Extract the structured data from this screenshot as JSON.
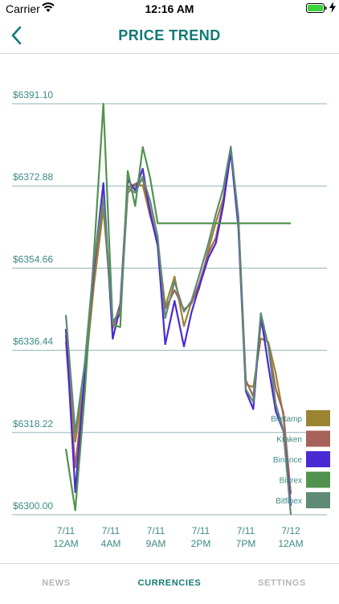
{
  "status_bar": {
    "carrier": "Carrier",
    "time": "12:16 AM"
  },
  "nav": {
    "title": "PRICE TREND",
    "back_icon": "chevron-left-icon"
  },
  "tabs": [
    {
      "label": "NEWS",
      "active": false
    },
    {
      "label": "CURRENCIES",
      "active": true
    },
    {
      "label": "SETTINGS",
      "active": false
    }
  ],
  "colors": {
    "accent": "#117a75",
    "gridline": "#8fb6b6",
    "axis_text": "#3d8a86"
  },
  "chart_data": {
    "type": "line",
    "ylim": [
      6300.0,
      6391.1
    ],
    "y_ticks": [
      6300.0,
      6318.22,
      6336.44,
      6354.66,
      6372.88,
      6391.1
    ],
    "y_tick_labels": [
      "$6300.00",
      "$6318.22",
      "$6336.44",
      "$6354.66",
      "$6372.88",
      "$6391.10"
    ],
    "x_range": [
      -0.3,
      12.55
    ],
    "x_ticks": [
      0,
      2.4,
      4.8,
      7.2,
      9.6,
      12
    ],
    "x_tick_labels": [
      [
        "7/11",
        "12AM"
      ],
      [
        "7/11",
        "4AM"
      ],
      [
        "7/11",
        "9AM"
      ],
      [
        "7/11",
        "2PM"
      ],
      [
        "7/11",
        "7PM"
      ],
      [
        "7/12",
        "12AM"
      ]
    ],
    "x": [
      0,
      0.5,
      1,
      1.5,
      2,
      2.5,
      2.9,
      3.3,
      3.7,
      4.1,
      4.5,
      4.9,
      5.3,
      5.8,
      6.3,
      6.7,
      7.1,
      7.6,
      8.0,
      8.4,
      8.8,
      9.2,
      9.6,
      10.0,
      10.4,
      10.8,
      11.2,
      11.6,
      12.0
    ],
    "series": [
      {
        "name": "Bitstamp",
        "color": "#9b8533",
        "values": [
          6339.8,
          6316.2,
          6330.0,
          6351.0,
          6367.8,
          6342.9,
          6344.2,
          6371.3,
          6373.0,
          6373.0,
          6366.2,
          6360.6,
          6346.2,
          6352.8,
          6341.8,
          6347.2,
          6350.0,
          6358.6,
          6364.8,
          6370.1,
          6380.8,
          6365.6,
          6328.9,
          6328.3,
          6339.1,
          6338.3,
          6331.3,
          6322.0,
          6304.6
        ]
      },
      {
        "name": "Kraken",
        "color": "#a6625a",
        "values": [
          6338.4,
          6310.5,
          6330.0,
          6353.6,
          6370.5,
          6341.3,
          6346.8,
          6372.5,
          6373.3,
          6374.3,
          6367.5,
          6359.5,
          6345.6,
          6349.8,
          6345.5,
          6346.8,
          6351.1,
          6357.9,
          6361.4,
          6369.4,
          6380.8,
          6366.2,
          6329.8,
          6326.2,
          6342.6,
          6337.8,
          6327.9,
          6322.7,
          6304.6
        ]
      },
      {
        "name": "Binance",
        "color": "#4a2ad4",
        "values": [
          6341.2,
          6305.0,
          6331.0,
          6355.0,
          6373.5,
          6339.0,
          6346.0,
          6374.3,
          6371.9,
          6376.7,
          6366.6,
          6359.7,
          6337.8,
          6347.4,
          6337.3,
          6344.8,
          6350.4,
          6356.9,
          6360.2,
          6368.6,
          6380.5,
          6363.7,
          6327.4,
          6323.4,
          6344.2,
          6333.1,
          6322.9,
          6318.6,
          6302.0
        ]
      },
      {
        "name": "Bittrex",
        "color": "#52924f",
        "values": [
          6314.6,
          6301.0,
          6326.2,
          6358.0,
          6391.1,
          6342.1,
          6341.6,
          6376.2,
          6368.4,
          6381.5,
          6374.6,
          6364.6,
          6364.6,
          6364.6,
          6364.6,
          6364.6,
          6364.6,
          6364.6,
          6364.6,
          6364.6,
          6364.6,
          6364.6,
          6364.6,
          6364.6,
          6364.6,
          6364.6,
          6364.6,
          6364.6,
          6364.6
        ]
      },
      {
        "name": "Bitfinex",
        "color": "#5e8a76",
        "values": [
          6344.3,
          6318.2,
          6333.2,
          6356.2,
          6370.3,
          6342.7,
          6345.3,
          6372.4,
          6371.4,
          6374.9,
          6369.5,
          6361.6,
          6343.6,
          6351.7,
          6345.0,
          6347.4,
          6352.9,
          6360.1,
          6366.6,
          6372.4,
          6381.6,
          6366.0,
          6327.8,
          6325.0,
          6344.7,
          6337.4,
          6324.5,
          6318.8,
          6300.0
        ]
      }
    ]
  }
}
